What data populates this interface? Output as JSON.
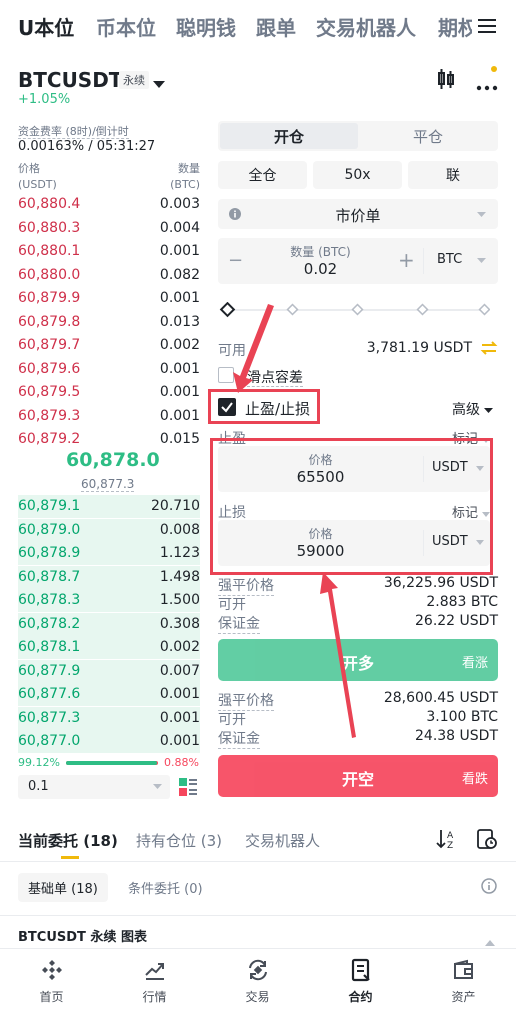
{
  "top_tabs": [
    "U本位",
    "币本位",
    "聪明钱",
    "跟单",
    "交易机器人",
    "期权"
  ],
  "symbol": {
    "name": "BTCUSDT",
    "type_badge": "永续",
    "change": "+1.05%"
  },
  "funding": {
    "label": "资金费率 (8时)/倒计时",
    "value": "0.00163% / 05:31:27"
  },
  "orderbook": {
    "price_header": "价格\n(USDT)",
    "qty_header": "数量\n(BTC)",
    "price_header_1": "价格",
    "price_header_2": "(USDT)",
    "qty_header_1": "数量",
    "qty_header_2": "(BTC)",
    "asks": [
      {
        "price": "60,880.4",
        "qty": "0.003"
      },
      {
        "price": "60,880.3",
        "qty": "0.004"
      },
      {
        "price": "60,880.1",
        "qty": "0.001"
      },
      {
        "price": "60,880.0",
        "qty": "0.082"
      },
      {
        "price": "60,879.9",
        "qty": "0.001"
      },
      {
        "price": "60,879.8",
        "qty": "0.013"
      },
      {
        "price": "60,879.7",
        "qty": "0.002"
      },
      {
        "price": "60,879.6",
        "qty": "0.001"
      },
      {
        "price": "60,879.5",
        "qty": "0.001"
      },
      {
        "price": "60,879.3",
        "qty": "0.001"
      },
      {
        "price": "60,879.2",
        "qty": "0.015"
      }
    ],
    "last_price": "60,878.0",
    "mark_price": "60,877.3",
    "bids": [
      {
        "price": "60,879.1",
        "qty": "20.710"
      },
      {
        "price": "60,879.0",
        "qty": "0.008"
      },
      {
        "price": "60,878.9",
        "qty": "1.123"
      },
      {
        "price": "60,878.7",
        "qty": "1.498"
      },
      {
        "price": "60,878.3",
        "qty": "1.500"
      },
      {
        "price": "60,878.2",
        "qty": "0.308"
      },
      {
        "price": "60,878.1",
        "qty": "0.002"
      },
      {
        "price": "60,877.9",
        "qty": "0.007"
      },
      {
        "price": "60,877.6",
        "qty": "0.001"
      },
      {
        "price": "60,877.3",
        "qty": "0.001"
      },
      {
        "price": "60,877.0",
        "qty": "0.001"
      }
    ],
    "buy_pct": "99.12%",
    "sell_pct": "0.88%",
    "buy_ratio": 0.9912,
    "depth_select": "0.1"
  },
  "order_form": {
    "open_tab": "开仓",
    "close_tab": "平仓",
    "margin_mode": "全仓",
    "leverage": "50x",
    "mode": "联",
    "order_type": "市价单",
    "qty_label": "数量 (BTC)",
    "qty_value": "0.02",
    "qty_unit": "BTC",
    "slider_percent": 0,
    "available_label": "可用",
    "available_value": "3,781.19 USDT",
    "slippage_label": "滑点容差",
    "tpsl_label": "止盈/止损",
    "advanced_label": "高级",
    "tp_label": "止盈",
    "tp_mark": "标记",
    "tp_price_label": "价格",
    "tp_price": "65500",
    "tp_unit": "USDT",
    "sl_label": "止损",
    "sl_mark": "标记",
    "sl_price_label": "价格",
    "sl_price": "59000",
    "sl_unit": "USDT",
    "long_info": {
      "liq_label": "强平价格",
      "liq_value": "36,225.96 USDT",
      "open_label": "可开",
      "open_value": "2.883 BTC",
      "margin_label": "保证金",
      "margin_value": "26.22 USDT"
    },
    "long_button": "开多",
    "long_hint": "看涨",
    "short_info": {
      "liq_label": "强平价格",
      "liq_value": "28,600.45 USDT",
      "open_label": "可开",
      "open_value": "3.100 BTC",
      "margin_label": "保证金",
      "margin_value": "24.38 USDT"
    },
    "short_button": "开空",
    "short_hint": "看跌"
  },
  "bottom_tabs": {
    "orders": "当前委托 (18)",
    "positions": "持有仓位 (3)",
    "bots": "交易机器人"
  },
  "sub_tabs": {
    "basic": "基础单 (18)",
    "conditional": "条件委托 (0)"
  },
  "chart_row": "BTCUSDT 永续 图表",
  "nav": [
    "首页",
    "行情",
    "交易",
    "合约",
    "资产"
  ],
  "colors": {
    "green": "#2ebd85",
    "red": "#f6465d",
    "accent": "#f0b90b",
    "annotation": "#e94354"
  }
}
